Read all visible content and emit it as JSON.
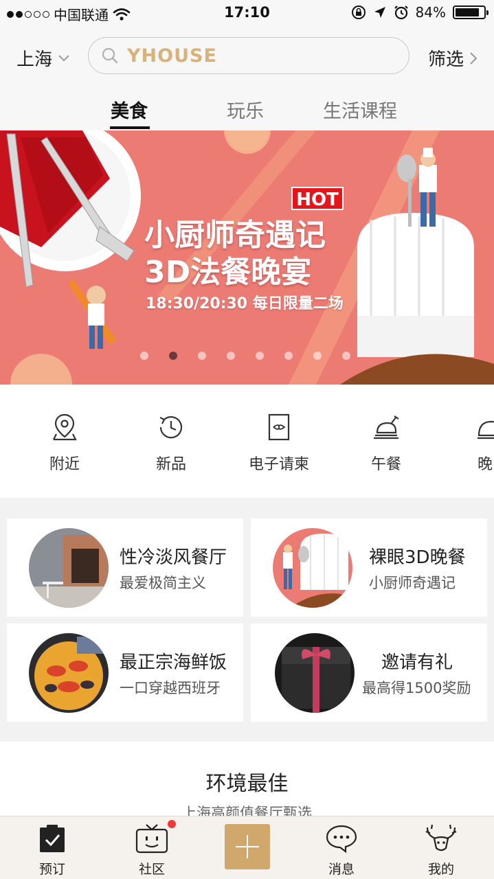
{
  "status_bar": {
    "carrier": "中国联通",
    "time": "17:10",
    "battery_percent_text": "84%",
    "battery_level": 0.84
  },
  "header": {
    "city": "上海",
    "search_brand": "YHOUSE",
    "filter_label": "筛选",
    "tabs": [
      {
        "label": "美食"
      },
      {
        "label": "玩乐"
      },
      {
        "label": "生活课程"
      }
    ],
    "active_tab_index": 0
  },
  "banner": {
    "badge": "HOT",
    "title_line1": "小厨师奇遇记",
    "title_line2": "3D法餐晚宴",
    "subtitle": "18:30/20:30 每日限量二场",
    "page_count": 8,
    "active_page_index": 1,
    "background_color": "#ec7b74"
  },
  "categories": [
    {
      "label": "附近",
      "icon": "map-pin-icon"
    },
    {
      "label": "新品",
      "icon": "clock-refresh-icon"
    },
    {
      "label": "电子请柬",
      "icon": "invitation-card-icon"
    },
    {
      "label": "午餐",
      "icon": "roast-chicken-icon"
    },
    {
      "label": "晚",
      "icon": "cloche-icon"
    }
  ],
  "cards": [
    {
      "title": "性冷淡风餐厅",
      "subtitle": "最爱极简主义",
      "image": "restaurant-storefront-image"
    },
    {
      "title": "裸眼3D晚餐",
      "subtitle": "小厨师奇遇记",
      "image": "chef-hat-3d-image"
    },
    {
      "title": "最正宗海鲜饭",
      "subtitle": "一口穿越西班牙",
      "image": "seafood-paella-image"
    },
    {
      "title": "邀请有礼",
      "subtitle": "最高得1500奖励",
      "image": "gift-box-image"
    }
  ],
  "section": {
    "title": "环境最佳",
    "subtitle": "上海高颜值餐厅甄选"
  },
  "bottom_nav": [
    {
      "label": "预订",
      "icon": "booking-check-icon",
      "active": true
    },
    {
      "label": "社区",
      "icon": "tv-smiley-icon",
      "has_badge": true
    },
    {
      "label": "",
      "icon": "plus-icon"
    },
    {
      "label": "消息",
      "icon": "chat-bubble-icon"
    },
    {
      "label": "我的",
      "icon": "antler-icon"
    }
  ],
  "colors": {
    "accent_gold": "#d0a86b",
    "brand_text": "#d9b27a",
    "badge_red": "#e4161c",
    "notify_red": "#f23a3a"
  }
}
